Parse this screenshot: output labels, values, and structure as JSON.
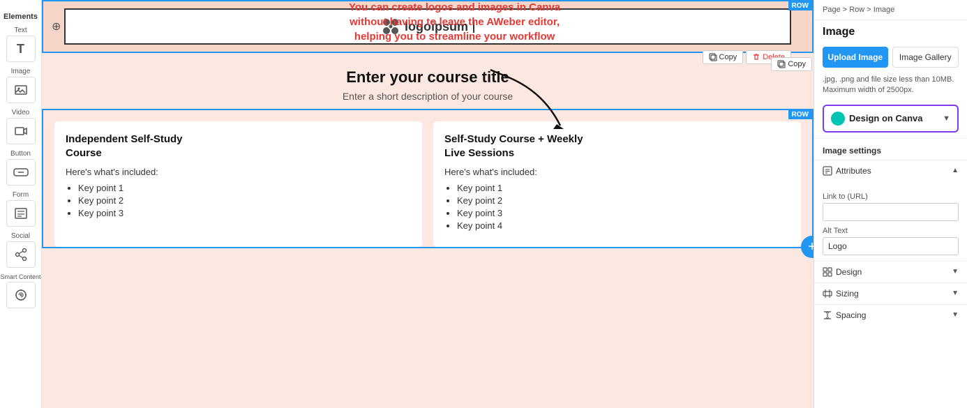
{
  "sidebar": {
    "elements_label": "Elements",
    "sections": [
      {
        "id": "text",
        "label": "Text",
        "icon": "T"
      },
      {
        "id": "image",
        "label": "Image",
        "icon": "🖼"
      },
      {
        "id": "video",
        "label": "Video",
        "icon": "▶"
      },
      {
        "id": "button",
        "label": "Button",
        "icon": "⬛"
      },
      {
        "id": "form",
        "label": "Form",
        "icon": "📋"
      },
      {
        "id": "social",
        "label": "Social",
        "icon": "↑"
      },
      {
        "id": "smart_content",
        "label": "Smart Content",
        "icon": "⚙"
      }
    ]
  },
  "canvas": {
    "row_label": "ROW",
    "logo_alt": "logoipsum",
    "logo_text": "logoipsum",
    "copy_btn": "Copy",
    "delete_btn": "Delete",
    "copy_row_btn": "Copy",
    "course_title": "Enter your course title",
    "course_subtitle": "Enter a short description of your course",
    "cards": [
      {
        "title": "Independent Self-Study Course",
        "subtitle": "Here's what's included:",
        "points": [
          "Key point 1",
          "Key point 2",
          "Key point 3"
        ]
      },
      {
        "title": "Self-Study Course + Weekly Live Sessions",
        "subtitle": "Here's what's included:",
        "points": [
          "Key point 1",
          "Key point 2",
          "Key point 3",
          "Key point 4"
        ]
      }
    ]
  },
  "annotation": {
    "line1": "You can create logos and images in Canva",
    "line2": "without having to leave the AWeber editor,",
    "line3": "helping you to streamline your workflow"
  },
  "right_panel": {
    "breadcrumb": "Page > Row >",
    "breadcrumb_current": "Image",
    "panel_title": "Image",
    "upload_btn": "Upload Image",
    "gallery_btn": "Image Gallery",
    "file_info": ".jpg, .png and file size less than 10MB. Maximum width of 2500px.",
    "canva_btn_label": "Design on Canva",
    "image_settings_label": "Image settings",
    "attributes_label": "Attributes",
    "link_label": "Link to (URL)",
    "alt_text_label": "Alt Text",
    "alt_text_value": "Logo",
    "design_label": "Design",
    "sizing_label": "Sizing",
    "spacing_label": "Spacing"
  }
}
